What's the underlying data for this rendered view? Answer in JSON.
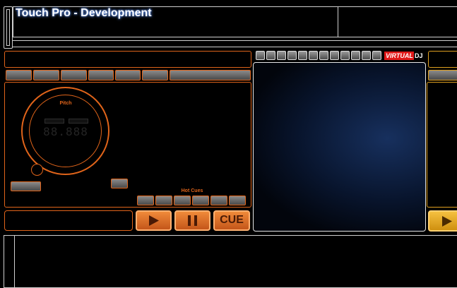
{
  "header": {
    "title": "Touch Pro - Development"
  },
  "brand": {
    "logo_text": "VIRTUALDJ",
    "logo_part1": "VIRTUAL",
    "logo_part2": "DJ"
  },
  "deck_left": {
    "jog": {
      "label": "Pitch",
      "readout": "88.888"
    },
    "hotcues": {
      "label": "Hot Cues"
    },
    "transport": {
      "play_icon": "play-icon",
      "pause_icon": "pause-icon",
      "cue_label": "CUE"
    }
  },
  "colors": {
    "accent": "#e0641a",
    "deck_right_accent": "#e0a020",
    "background": "#000000"
  }
}
